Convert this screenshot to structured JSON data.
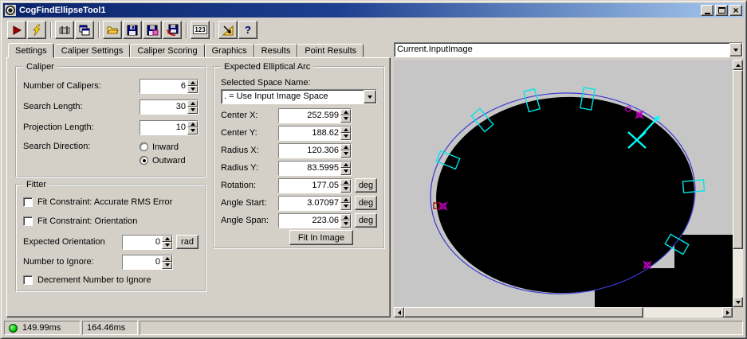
{
  "titlebar": {
    "title": "CogFindEllipseTool1"
  },
  "toolbar": {
    "buttons": [
      "run",
      "electric-run",
      "caliper-shapes",
      "copy-window",
      "open-file",
      "save",
      "save-image",
      "save-results",
      "display-values",
      "position-tool",
      "help"
    ],
    "num_label": "123"
  },
  "tabs": {
    "items": [
      "Settings",
      "Caliper Settings",
      "Caliper Scoring",
      "Graphics",
      "Results",
      "Point Results"
    ],
    "active": "Settings"
  },
  "caliper": {
    "title": "Caliper",
    "number_of_calipers_label": "Number of Calipers:",
    "number_of_calipers_value": "6",
    "search_length_label": "Search Length:",
    "search_length_value": "30",
    "projection_length_label": "Projection Length:",
    "projection_length_value": "10",
    "search_direction_label": "Search Direction:",
    "inward_label": "Inward",
    "outward_label": "Outward",
    "search_direction_selected": "Outward"
  },
  "fitter": {
    "title": "Fitter",
    "rms_label": "Fit Constraint: Accurate RMS Error",
    "rms_checked": false,
    "orientation_label": "Fit Constraint: Orientation",
    "orientation_checked": false,
    "expected_orientation_label": "Expected Orientation",
    "expected_orientation_value": "0",
    "expected_orientation_unit": "rad",
    "number_to_ignore_label": "Number to Ignore:",
    "number_to_ignore_value": "0",
    "decrement_label": "Decrement Number to Ignore",
    "decrement_checked": false
  },
  "arc": {
    "title": "Expected Elliptical Arc",
    "space_name_label": "Selected Space Name:",
    "space_name_value": ". = Use Input Image Space",
    "center_x_label": "Center X:",
    "center_x_value": "252.599",
    "center_y_label": "Center Y:",
    "center_y_value": "188.62",
    "radius_x_label": "Radius X:",
    "radius_x_value": "120.306",
    "radius_y_label": "Radius Y:",
    "radius_y_value": "83.5995",
    "rotation_label": "Rotation:",
    "rotation_value": "177.05",
    "rotation_unit": "deg",
    "angle_start_label": "Angle Start:",
    "angle_start_value": "3.07097",
    "angle_start_unit": "deg",
    "angle_span_label": "Angle Span:",
    "angle_span_value": "223.06",
    "angle_span_unit": "deg",
    "fit_in_image_label": "Fit In Image"
  },
  "display": {
    "source": "Current.InputImage"
  },
  "statusbar": {
    "time1": "149.99ms",
    "time2": "164.46ms"
  },
  "colors": {
    "titlebar_start": "#0a246a",
    "titlebar_end": "#a6caf0",
    "caliper_overlay": "#00e6e6",
    "marker": "#cc00cc",
    "fit_ellipse": "#3a3ad0",
    "led": "#00c000"
  }
}
